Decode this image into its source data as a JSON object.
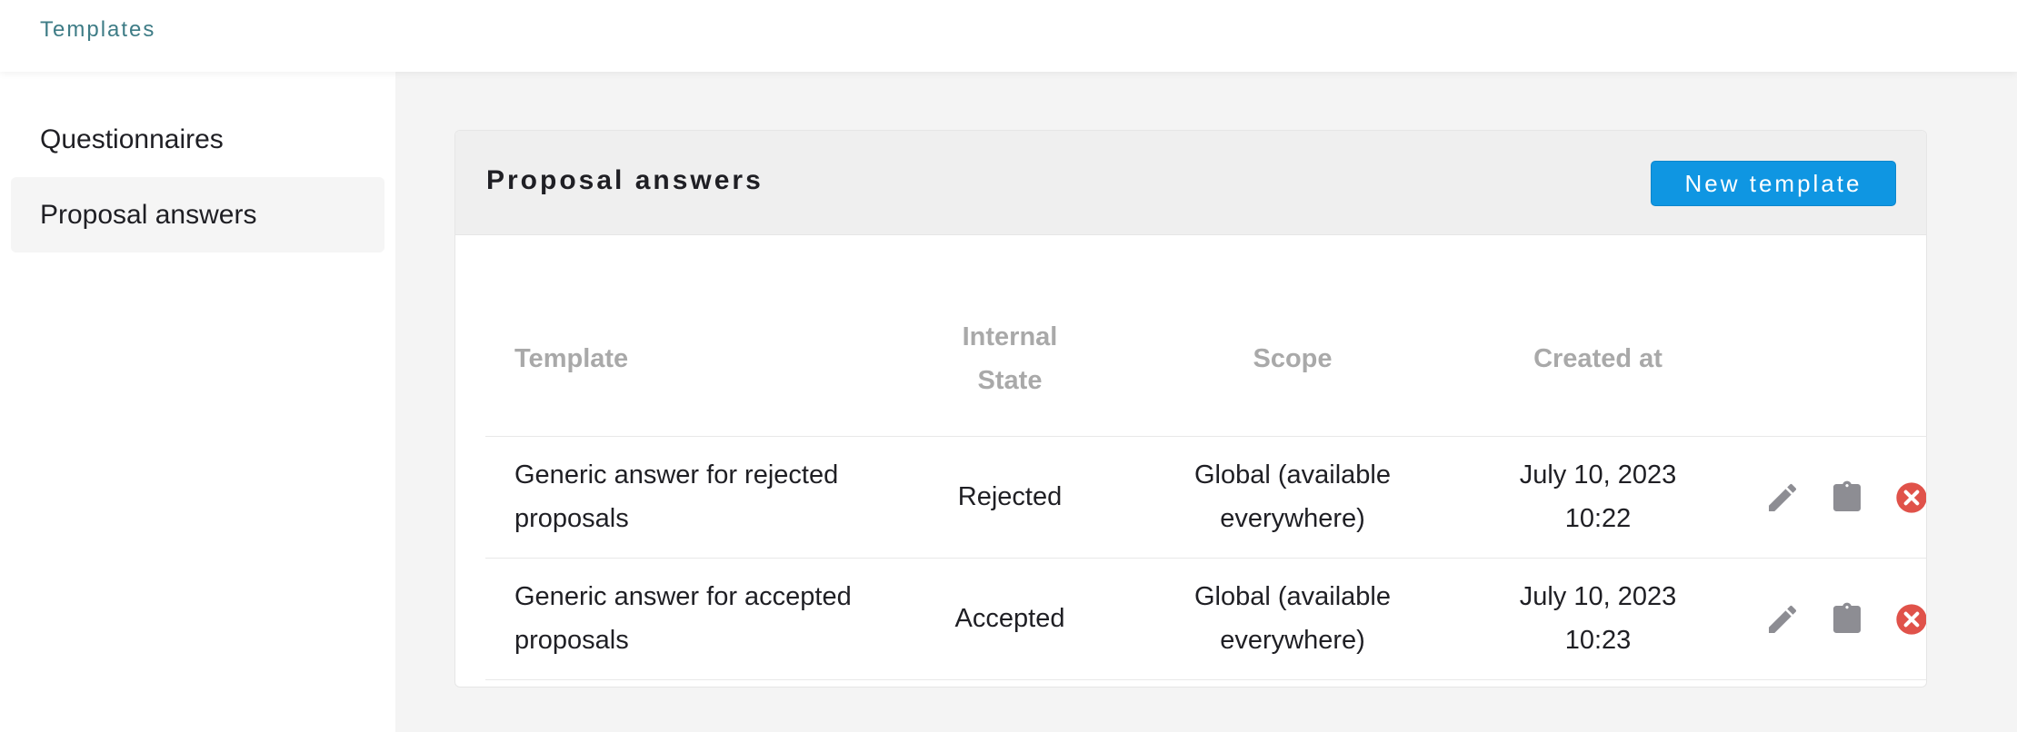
{
  "breadcrumb": "Templates",
  "sidebar": {
    "items": [
      {
        "label": "Questionnaires",
        "active": false
      },
      {
        "label": "Proposal answers",
        "active": true
      }
    ]
  },
  "card": {
    "title": "Proposal answers",
    "new_button": "New template"
  },
  "table": {
    "headers": {
      "template": "Template",
      "internal_state_line1": "Internal",
      "internal_state_line2": "State",
      "scope": "Scope",
      "created_at": "Created at"
    },
    "rows": [
      {
        "template_line1": "Generic answer for rejected",
        "template_line2": "proposals",
        "internal_state": "Rejected",
        "scope_line1": "Global (available",
        "scope_line2": "everywhere)",
        "created_date": "July 10, 2023",
        "created_time": "10:22"
      },
      {
        "template_line1": "Generic answer for accepted",
        "template_line2": "proposals",
        "internal_state": "Accepted",
        "scope_line1": "Global (available",
        "scope_line2": "everywhere)",
        "created_date": "July 10, 2023",
        "created_time": "10:23"
      }
    ]
  },
  "icons": {
    "edit": "pencil-icon",
    "copy": "clipboard-icon",
    "delete": "close-circle-icon"
  },
  "colors": {
    "accent": "#0f96e2",
    "breadcrumb": "#3e7c86",
    "icon_gray": "#8d8d93",
    "danger": "#e0524a"
  }
}
